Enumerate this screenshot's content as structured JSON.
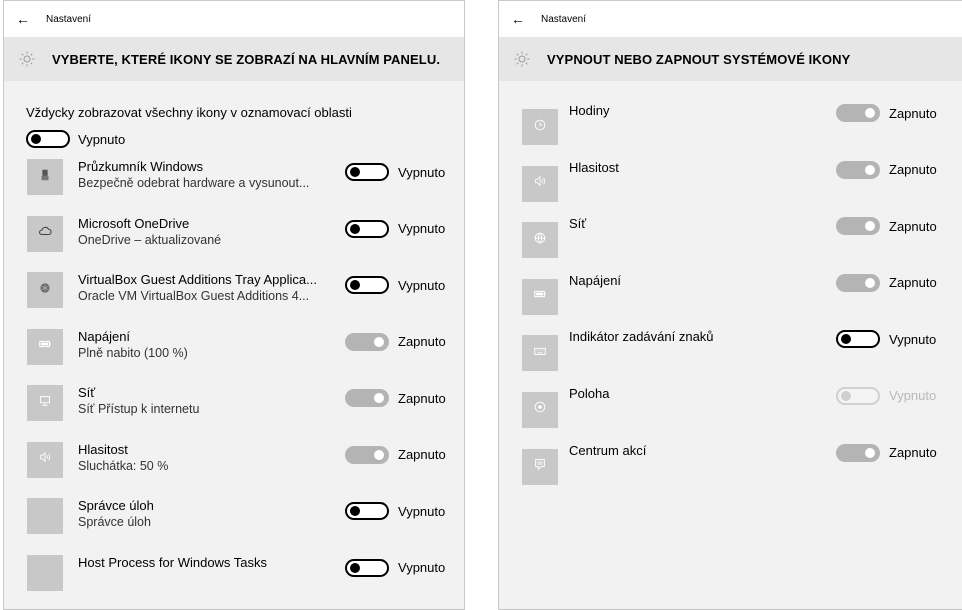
{
  "left": {
    "window_title": "Nastavení",
    "header": "VYBERTE, KTERÉ IKONY SE ZOBRAZÍ NA HLAVNÍM PANELU.",
    "master": {
      "label": "Vždycky zobrazovat všechny ikony v oznamovací oblasti",
      "state": "Vypnuto"
    },
    "items": [
      {
        "name": "Průzkumník Windows",
        "desc": "Bezpečně odebrat hardware a vysunout...",
        "state": "Vypnuto",
        "on": false,
        "icon": "usb-icon"
      },
      {
        "name": "Microsoft OneDrive",
        "desc": "OneDrive – aktualizované",
        "state": "Vypnuto",
        "on": false,
        "icon": "cloud-icon"
      },
      {
        "name": "VirtualBox Guest Additions Tray Applica...",
        "desc": "Oracle VM VirtualBox Guest Additions 4...",
        "state": "Vypnuto",
        "on": false,
        "icon": "virtualbox-icon"
      },
      {
        "name": "Napájení",
        "desc": "Plně nabito (100 %)",
        "state": "Zapnuto",
        "on": true,
        "icon": "battery-icon"
      },
      {
        "name": "Síť",
        "desc": "Síť Přístup k internetu",
        "state": "Zapnuto",
        "on": true,
        "icon": "network-icon"
      },
      {
        "name": "Hlasitost",
        "desc": "Sluchátka: 50 %",
        "state": "Zapnuto",
        "on": true,
        "icon": "volume-icon"
      },
      {
        "name": "Správce úloh",
        "desc": "Správce úloh",
        "state": "Vypnuto",
        "on": false,
        "icon": ""
      },
      {
        "name": "Host Process for Windows Tasks",
        "desc": "",
        "state": "Vypnuto",
        "on": false,
        "icon": ""
      }
    ]
  },
  "right": {
    "window_title": "Nastavení",
    "header": "VYPNOUT NEBO ZAPNOUT SYSTÉMOVÉ IKONY",
    "items": [
      {
        "name": "Hodiny",
        "state": "Zapnuto",
        "mode": "on",
        "icon": "clock-icon"
      },
      {
        "name": "Hlasitost",
        "state": "Zapnuto",
        "mode": "on",
        "icon": "volume-icon"
      },
      {
        "name": "Síť",
        "state": "Zapnuto",
        "mode": "on",
        "icon": "globe-icon"
      },
      {
        "name": "Napájení",
        "state": "Zapnuto",
        "mode": "on",
        "icon": "battery-icon"
      },
      {
        "name": "Indikátor zadávání znaků",
        "state": "Vypnuto",
        "mode": "off",
        "icon": "keyboard-icon"
      },
      {
        "name": "Poloha",
        "state": "Vypnuto",
        "mode": "disabled",
        "icon": "location-icon"
      },
      {
        "name": "Centrum akcí",
        "state": "Zapnuto",
        "mode": "on",
        "icon": "action-center-icon"
      }
    ]
  }
}
